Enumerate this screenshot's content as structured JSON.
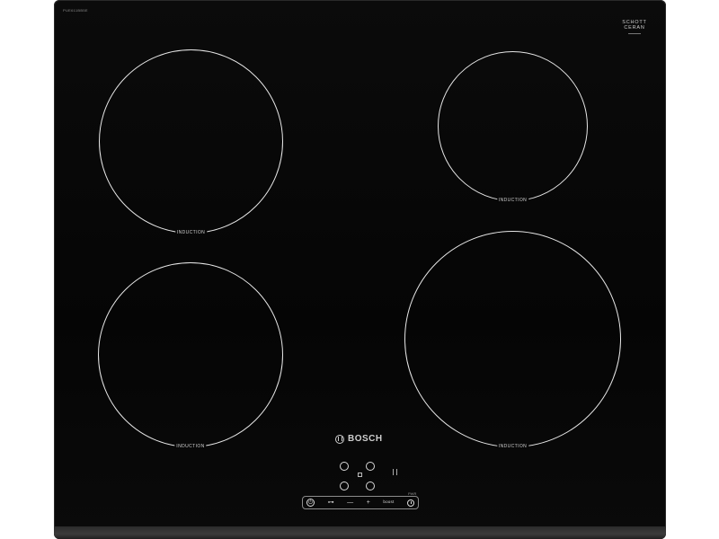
{
  "product": {
    "model_code": "PUE611BB5E",
    "glass_brand_line1": "SCHOTT",
    "glass_brand_line2": "CERAN",
    "brand_name": "BOSCH",
    "brand_logo_icon": "bosch-armature-icon"
  },
  "zones": [
    {
      "id": "front-left",
      "label": "INDUCTION"
    },
    {
      "id": "rear-right",
      "label": "INDUCTION"
    },
    {
      "id": "rear-left",
      "label": "INDUCTION"
    },
    {
      "id": "front-right",
      "label": "INDUCTION"
    }
  ],
  "controls": {
    "power_icon": "power-icon",
    "power_glyph": "⏻",
    "lock_icon": "key-lock-icon",
    "lock_glyph": "⊶",
    "minus_label": "—",
    "plus_label": "+",
    "boost_label": "boost",
    "timer_icon": "timer-icon",
    "strip_tag": "PWR"
  },
  "colors": {
    "glass": "#070707",
    "printing": "#e6e6e6",
    "trim": "#2f2f2f"
  }
}
